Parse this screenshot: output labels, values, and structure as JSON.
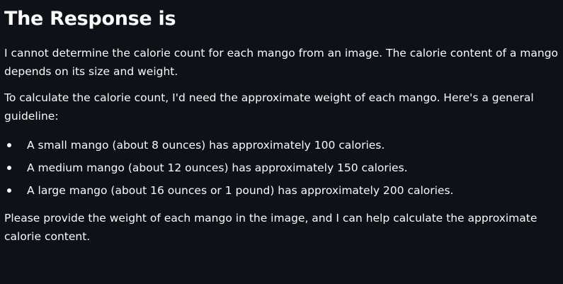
{
  "heading": "The Response is",
  "paragraphs": {
    "intro": "I cannot determine the calorie count for each mango from an image. The calorie content of a mango depends on its size and weight.",
    "guideline": "To calculate the calorie count, I'd need the approximate weight of each mango. Here's a general guideline:",
    "closing": "Please provide the weight of each mango in the image, and I can help calculate the approximate calorie content."
  },
  "bullets": [
    "A small mango (about 8 ounces) has approximately 100 calories.",
    "A medium mango (about 12 ounces) has approximately 150 calories.",
    "A large mango (about 16 ounces or 1 pound) has approximately 200 calories."
  ],
  "colors": {
    "background": "#0e1117",
    "text": "#fafafa"
  }
}
